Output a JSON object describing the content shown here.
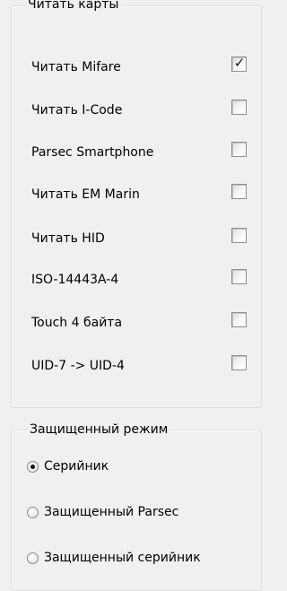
{
  "read_cards": {
    "title": "Читать карты",
    "items": [
      {
        "label": "Читать Mifare",
        "checked": true
      },
      {
        "label": "Читать I-Code",
        "checked": false
      },
      {
        "label": "Parsec Smartphone",
        "checked": false
      },
      {
        "label": "Читать EM Marin",
        "checked": false
      },
      {
        "label": "Читать HID",
        "checked": false
      },
      {
        "label": "ISO-14443A-4",
        "checked": false
      },
      {
        "label": "Touch 4 байта",
        "checked": false
      },
      {
        "label": "UID-7 -> UID-4",
        "checked": false
      }
    ]
  },
  "secure_mode": {
    "title": "Защищенный режим",
    "options": [
      {
        "label": "Серийник",
        "selected": true
      },
      {
        "label": "Защищенный Parsec",
        "selected": false
      },
      {
        "label": "Защищенный серийник",
        "selected": false
      }
    ]
  },
  "check_glyph": "✓"
}
